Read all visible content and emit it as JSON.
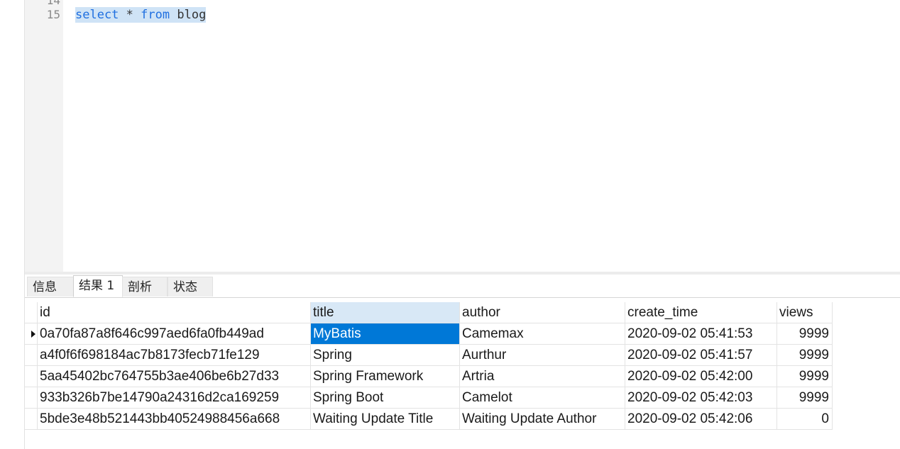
{
  "editor": {
    "lines": [
      {
        "number": "14",
        "text": ""
      },
      {
        "number": "15",
        "text": "select * from blog"
      }
    ],
    "query_tokens": {
      "kw1": "select",
      "star": "*",
      "kw2": "from",
      "table": "blog"
    },
    "colors": {
      "keyword": "#1f6fe0",
      "selection": "#cfe3f6"
    }
  },
  "tabs": [
    {
      "label": "信息",
      "active": false
    },
    {
      "label": "结果 1",
      "active": true
    },
    {
      "label": "剖析",
      "active": false
    },
    {
      "label": "状态",
      "active": false
    }
  ],
  "results": {
    "columns": [
      "id",
      "title",
      "author",
      "create_time",
      "views"
    ],
    "rows": [
      [
        "0a70fa87a8f646c997aed6fa0fb449ad",
        "MyBatis",
        "Camemax",
        "2020-09-02 05:41:53",
        "9999"
      ],
      [
        "a4f0f6f698184ac7b8173fecb71fe129",
        "Spring",
        "Aurthur",
        "2020-09-02 05:41:57",
        "9999"
      ],
      [
        "5aa45402bc764755b3ae406be6b27d33",
        "Spring Framework",
        "Artria",
        "2020-09-02 05:42:00",
        "9999"
      ],
      [
        "933b326b7be14790a24316d2ca169259",
        "Spring Boot",
        "Camelot",
        "2020-09-02 05:42:03",
        "9999"
      ],
      [
        "5bde3e48b521443bb40524988456a668",
        "Waiting Update Title",
        "Waiting Update Author",
        "2020-09-02 05:42:06",
        "0"
      ]
    ],
    "selected_cell": {
      "row": 0,
      "column": "title"
    },
    "colors": {
      "selected_cell": "#0078d7",
      "selected_header": "#d8e8f6"
    }
  }
}
